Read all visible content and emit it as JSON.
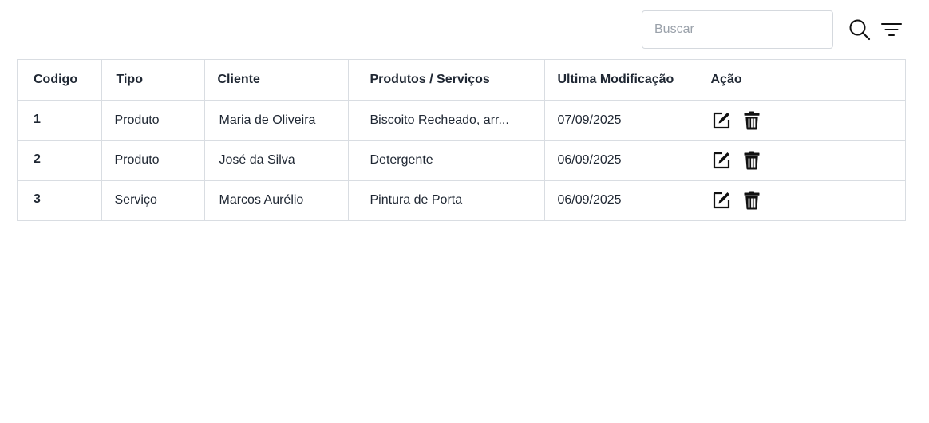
{
  "toolbar": {
    "search_placeholder": "Buscar",
    "search_value": "",
    "search_icon": "search-icon",
    "filter_icon": "filter-icon"
  },
  "table": {
    "headers": {
      "codigo": "Codigo",
      "tipo": "Tipo",
      "cliente": "Cliente",
      "produtos": "Produtos / Serviços",
      "modificacao": "Ultima Modificação",
      "acao": "Ação"
    },
    "rows": [
      {
        "codigo": "1",
        "tipo": "Produto",
        "cliente": "Maria de Oliveira",
        "produtos": "Biscoito Recheado, arr...",
        "modificacao": "07/09/2025"
      },
      {
        "codigo": "2",
        "tipo": "Produto",
        "cliente": "José da Silva",
        "produtos": "Detergente",
        "modificacao": "06/09/2025"
      },
      {
        "codigo": "3",
        "tipo": "Serviço",
        "cliente": "Marcos Aurélio",
        "produtos": "Pintura de Porta",
        "modificacao": "06/09/2025"
      }
    ],
    "row_actions": [
      "edit-icon",
      "trash-icon"
    ]
  },
  "colors": {
    "text": "#1f2733",
    "border": "#d9dde2",
    "placeholder": "#9aa1aa",
    "icon": "#111111"
  }
}
